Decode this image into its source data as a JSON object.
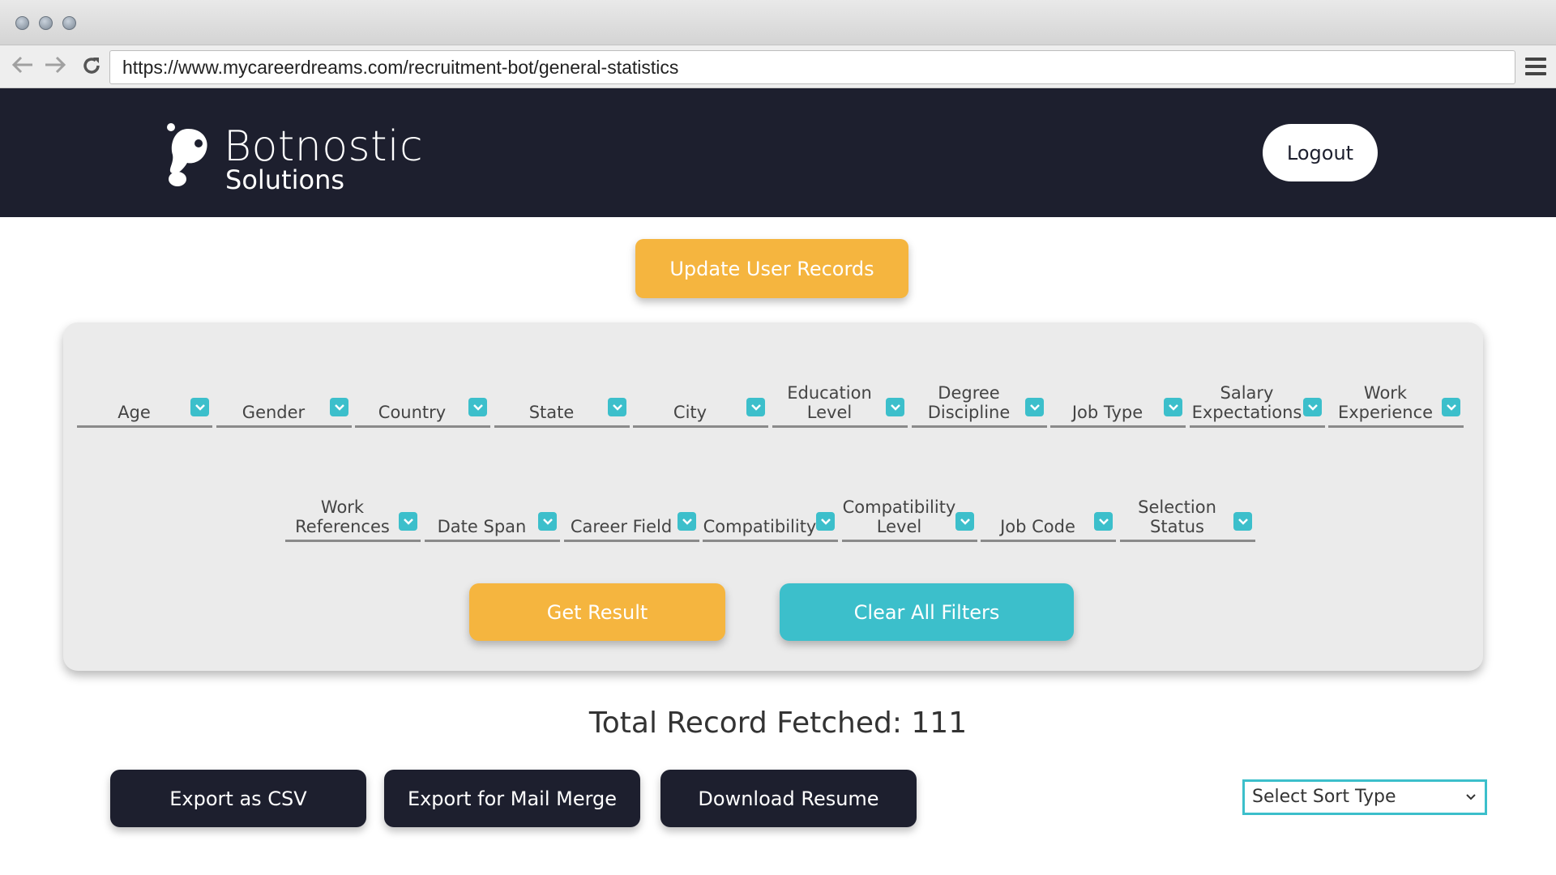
{
  "browser": {
    "url": "https://www.mycareerdreams.com/recruitment-bot/general-statistics"
  },
  "header": {
    "logo_title": "Botnostic",
    "logo_subtitle": "Solutions",
    "logout_label": "Logout"
  },
  "actions": {
    "update_label": "Update User Records"
  },
  "filters": {
    "row1": [
      "Age",
      "Gender",
      "Country",
      "State",
      "City",
      "Education Level",
      "Degree Discipline",
      "Job Type",
      "Salary Expectations",
      "Work Experience"
    ],
    "row2": [
      "Work References",
      "Date Span",
      "Career Field",
      "Compatibility",
      "Compatibility Level",
      "Job Code",
      "Selection Status"
    ],
    "get_result_label": "Get Result",
    "clear_label": "Clear All Filters"
  },
  "results": {
    "total_text": "Total Record Fetched: 111"
  },
  "exports": {
    "csv_label": "Export as CSV",
    "mail_merge_label": "Export for Mail Merge",
    "resume_label": "Download Resume"
  },
  "sort": {
    "selected": "Select Sort Type"
  },
  "colors": {
    "header_bg": "#1d1f2e",
    "accent_orange": "#f5b53f",
    "accent_teal": "#3cbfcb"
  }
}
